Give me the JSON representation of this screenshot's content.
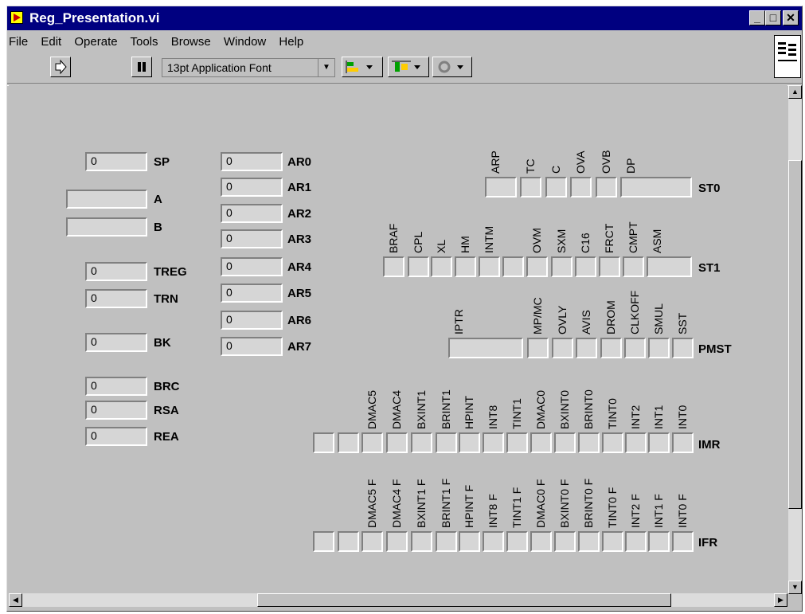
{
  "window": {
    "title": "Reg_Presentation.vi"
  },
  "menu": [
    "File",
    "Edit",
    "Operate",
    "Tools",
    "Browse",
    "Window",
    "Help"
  ],
  "toolbar": {
    "font": "13pt Application Font"
  },
  "left": {
    "SP": {
      "label": "SP",
      "value": "0"
    },
    "A": {
      "label": "A",
      "value": ""
    },
    "B": {
      "label": "B",
      "value": ""
    },
    "TREG": {
      "label": "TREG",
      "value": "0"
    },
    "TRN": {
      "label": "TRN",
      "value": "0"
    },
    "BK": {
      "label": "BK",
      "value": "0"
    },
    "BRC": {
      "label": "BRC",
      "value": "0"
    },
    "RSA": {
      "label": "RSA",
      "value": "0"
    },
    "REA": {
      "label": "REA",
      "value": "0"
    }
  },
  "ar": [
    {
      "label": "AR0",
      "value": "0"
    },
    {
      "label": "AR1",
      "value": "0"
    },
    {
      "label": "AR2",
      "value": "0"
    },
    {
      "label": "AR3",
      "value": "0"
    },
    {
      "label": "AR4",
      "value": "0"
    },
    {
      "label": "AR5",
      "value": "0"
    },
    {
      "label": "AR6",
      "value": "0"
    },
    {
      "label": "AR7",
      "value": "0"
    }
  ],
  "st0": {
    "label": "ST0",
    "bits": [
      "ARP",
      "TC",
      "C",
      "OVA",
      "OVB",
      "DP"
    ]
  },
  "st1": {
    "label": "ST1",
    "bits": [
      "BRAF",
      "CPL",
      "XL",
      "HM",
      "INTM",
      "",
      "OVM",
      "SXM",
      "C16",
      "FRCT",
      "CMPT",
      "ASM"
    ]
  },
  "pmst": {
    "label": "PMST",
    "bits": [
      "IPTR",
      "MP/MC",
      "OVLY",
      "AVIS",
      "DROM",
      "CLKOFF",
      "SMUL",
      "SST"
    ]
  },
  "imr": {
    "label": "IMR",
    "bits": [
      "",
      "",
      "DMAC5",
      "DMAC4",
      "BXINT1",
      "BRINT1",
      "HPINT",
      "INT8",
      "TINT1",
      "DMAC0",
      "BXINT0",
      "BRINT0",
      "TINT0",
      "INT2",
      "INT1",
      "INT0"
    ]
  },
  "ifr": {
    "label": "IFR",
    "bits": [
      "",
      "",
      "DMAC5 F",
      "DMAC4 F",
      "BXINT1 F",
      "BRINT1 F",
      "HPINT F",
      "INT8 F",
      "TINT1 F",
      "DMAC0 F",
      "BXINT0 F",
      "BRINT0 F",
      "TINT0 F",
      "INT2 F",
      "INT1 F",
      "INT0 F"
    ]
  }
}
